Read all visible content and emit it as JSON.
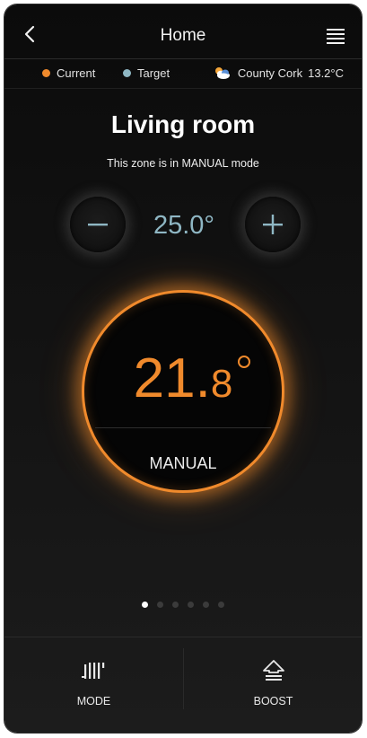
{
  "header": {
    "title": "Home",
    "back_icon": "chevron-left-icon",
    "menu_icon": "hamburger-menu-icon"
  },
  "legend": {
    "current_label": "Current",
    "current_color": "#f08a2c",
    "target_label": "Target",
    "target_color": "#8fb7c4"
  },
  "weather": {
    "icon": "sun-cloud-icon",
    "location": "County Cork",
    "temperature": "13.2°C"
  },
  "zone": {
    "name": "Living room",
    "mode_text": "This zone is in MANUAL mode"
  },
  "target": {
    "value": "25.0°",
    "decrease_icon": "minus-icon",
    "increase_icon": "plus-icon"
  },
  "dial": {
    "current_main": "21.",
    "current_decimal": "8",
    "mode": "MANUAL",
    "accent": "#f08a2c"
  },
  "pager": {
    "count": 6,
    "active": 1
  },
  "bottom": {
    "mode_label": "MODE",
    "mode_icon": "radiator-icon",
    "boost_label": "BOOST",
    "boost_icon": "boost-arrow-icon"
  }
}
